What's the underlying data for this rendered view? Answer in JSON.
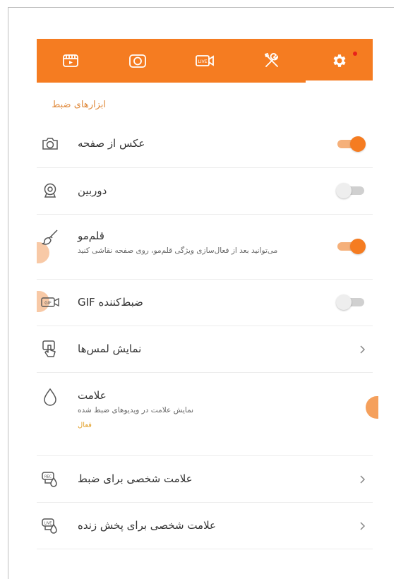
{
  "colors": {
    "accent": "#f57c21",
    "section": "#e08a3c",
    "status": "#e2a12a"
  },
  "tabs": [
    {
      "name": "video-list-icon",
      "active": false
    },
    {
      "name": "screenshot-icon",
      "active": false
    },
    {
      "name": "live-icon",
      "active": false
    },
    {
      "name": "tools-icon",
      "active": false
    },
    {
      "name": "settings-icon",
      "active": true,
      "badge": true
    }
  ],
  "section_title": "ابزارهای ضبط",
  "rows": {
    "screenshot": {
      "title": "عکس از صفحه",
      "icon": "camera-icon",
      "toggle": "on"
    },
    "camera": {
      "title": "دوربین",
      "icon": "webcam-icon",
      "toggle": "off"
    },
    "brush": {
      "title": "قلم‌مو",
      "subtitle": "می‌توانید بعد از فعال‌سازی ویژگی قلم‌مو، روی صفحه نقاشی کنید",
      "icon": "brush-icon",
      "toggle": "on"
    },
    "gif": {
      "title": "ضبط‌کننده GIF",
      "icon": "gif-icon",
      "toggle": "off"
    },
    "touches": {
      "title": "نمایش لمس‌ها",
      "icon": "touch-icon"
    },
    "watermark": {
      "title": "علامت",
      "subtitle": "نمایش علامت در ویدیوهای ضبط شده",
      "status": "فعال",
      "icon": "drop-icon"
    },
    "custom_rec": {
      "title": "علامت شخصی برای ضبط",
      "icon": "rec-watermark-icon"
    },
    "custom_live": {
      "title": "علامت شخصی برای پخش زنده",
      "icon": "live-watermark-icon"
    }
  }
}
